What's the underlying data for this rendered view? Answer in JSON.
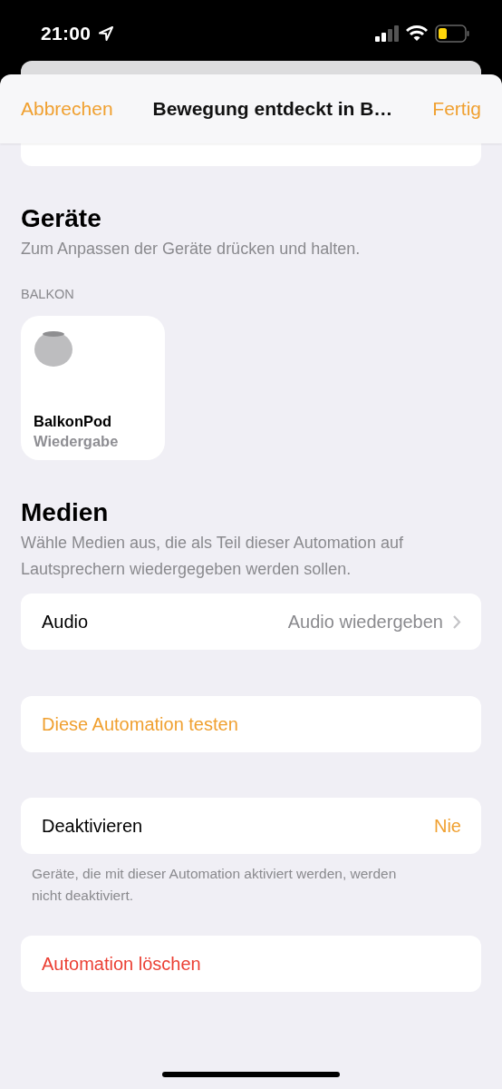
{
  "status_bar": {
    "time": "21:00"
  },
  "header": {
    "cancel": "Abbrechen",
    "title": "Bewegung entdeckt in B…",
    "done": "Fertig"
  },
  "devices": {
    "title": "Geräte",
    "subtitle": "Zum Anpassen der Geräte drücken und halten.",
    "room": "BALKON",
    "tiles": [
      {
        "name": "BalkonPod",
        "status": "Wiedergabe"
      }
    ]
  },
  "media": {
    "title": "Medien",
    "subtitle": "Wähle Medien aus, die als Teil dieser Automation auf Lautsprechern wiedergegeben werden sollen.",
    "row": {
      "label": "Audio",
      "value": "Audio wiedergeben"
    }
  },
  "test_button": "Diese Automation testen",
  "deactivate": {
    "label": "Deaktivieren",
    "value": "Nie",
    "footnote": "Geräte, die mit dieser Automation aktiviert werden, werden nicht deaktiviert."
  },
  "delete_button": "Automation löschen"
}
